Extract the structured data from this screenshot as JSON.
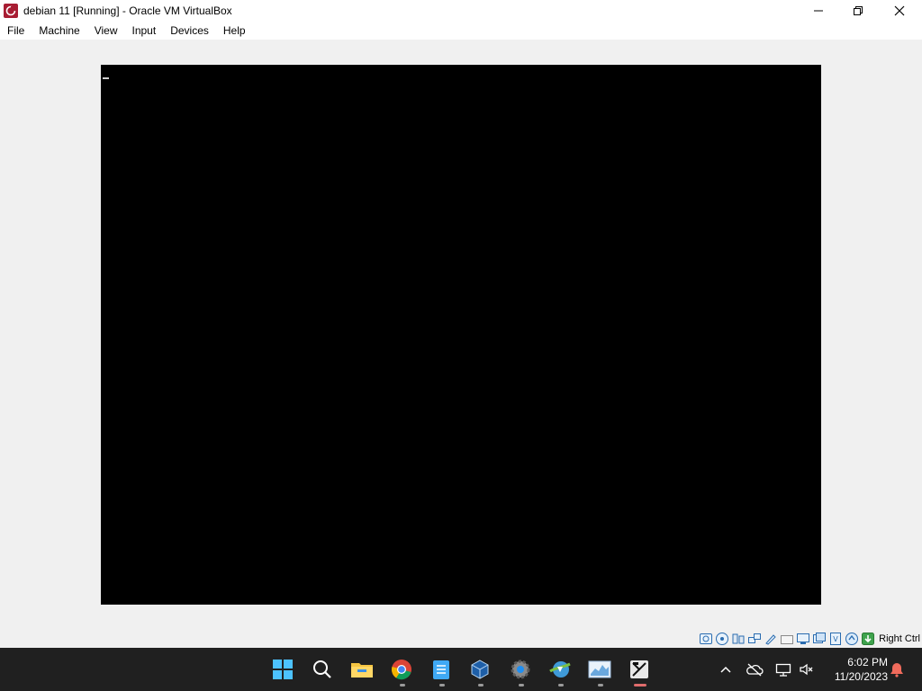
{
  "window": {
    "title": "debian 11 [Running] - Oracle VM VirtualBox"
  },
  "menubar": {
    "items": [
      "File",
      "Machine",
      "View",
      "Input",
      "Devices",
      "Help"
    ]
  },
  "statusbar": {
    "host_key_label": "Right Ctrl",
    "icons": [
      "hard-disk-icon",
      "optical-drive-icon",
      "audio-icon",
      "network-icon",
      "usb-icon",
      "shared-folders-icon",
      "display-icon",
      "recording-icon",
      "cpu-icon",
      "mouse-integration-icon",
      "keyboard-icon"
    ]
  },
  "taskbar": {
    "apps": [
      "start-icon",
      "search-icon",
      "file-explorer-icon",
      "chrome-icon",
      "notepad-icon",
      "virtualbox-icon",
      "settings-icon",
      "internet-download-manager-icon",
      "system-monitor-icon",
      "capcut-icon"
    ],
    "tray_icons": [
      "show-hidden-icons-chevron",
      "onedrive-icon",
      "network-icon",
      "volume-muted-icon",
      "notifications-bell-icon"
    ]
  },
  "clock": {
    "time": "6:02 PM",
    "date": "11/20/2023"
  },
  "colors": {
    "titlebar_bg": "#ffffff",
    "workarea_bg": "#f0f0f0",
    "vm_screen_bg": "#000000",
    "taskbar_bg": "#202020",
    "accent_blue": "#1f8ef1"
  }
}
